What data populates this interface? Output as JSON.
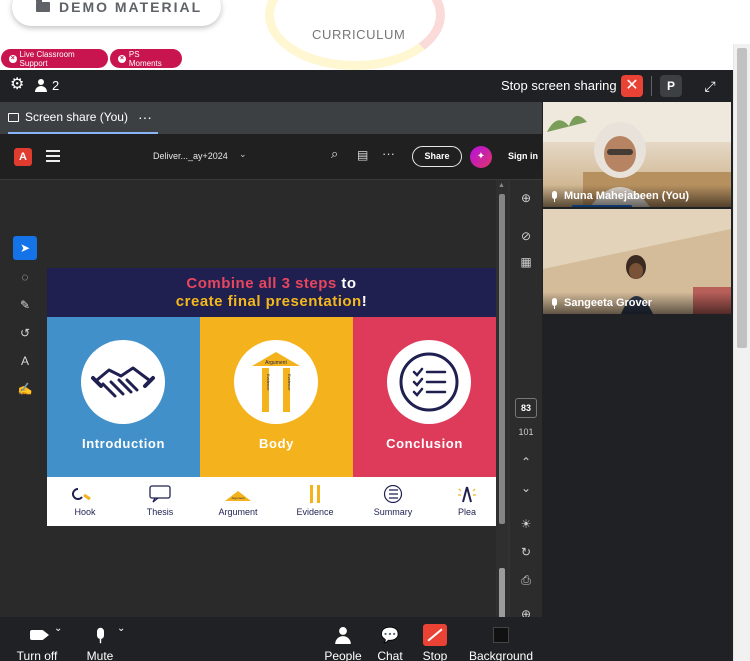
{
  "page": {
    "demo_button_label": "DEMO MATERIAL",
    "curriculum_label": "CURRICULUM",
    "chips": [
      {
        "label": "Live Classroom Support"
      },
      {
        "label": "PS Moments"
      }
    ]
  },
  "meeting": {
    "participant_count": "2",
    "stop_sharing_label": "Stop screen sharing",
    "stop_x": "✕",
    "profile_initial": "P",
    "share_tab_label": "Screen share (You)",
    "more_label": "···",
    "participants": [
      {
        "name": "Muna Mahejabeen (You)"
      },
      {
        "name": "Sangeeta Grover"
      }
    ],
    "controls": [
      {
        "label": "Turn off",
        "icon": "camera-icon"
      },
      {
        "label": "Mute",
        "icon": "mic-icon"
      },
      {
        "label": "People",
        "icon": "people-icon"
      },
      {
        "label": "Chat",
        "icon": "chat-icon"
      },
      {
        "label": "Stop",
        "icon": "stop-share-icon"
      },
      {
        "label": "Background",
        "icon": "background-icon"
      }
    ]
  },
  "pdf_viewer": {
    "document_name": "Deliver..._ay+2024",
    "share_label": "Share",
    "sign_in_label": "Sign in",
    "current_page": "83",
    "total_pages": "101"
  },
  "slide": {
    "heading_line1_colored": "Combine all 3 steps",
    "heading_line1_rest": " to",
    "heading_line2_colored": "create final presentation",
    "heading_line2_rest": "!",
    "panels": [
      {
        "title": "Introduction",
        "color": "#4190c9",
        "icon": "handshake-icon"
      },
      {
        "title": "Body",
        "color": "#f4b31c",
        "icon": "argument-pillars-icon",
        "pillar_caption": "Argument",
        "pillar_label": "Evidence"
      },
      {
        "title": "Conclusion",
        "color": "#de3b5b",
        "icon": "checklist-icon"
      }
    ],
    "strip": [
      {
        "label": "Hook",
        "icon": "hook-icon"
      },
      {
        "label": "Thesis",
        "icon": "speech-bubble-icon"
      },
      {
        "label": "Argument",
        "icon": "roof-icon",
        "caption": "Argument"
      },
      {
        "label": "Evidence",
        "icon": "pillars-icon"
      },
      {
        "label": "Summary",
        "icon": "list-circle-icon"
      },
      {
        "label": "Plea",
        "icon": "plea-icon"
      }
    ]
  },
  "colors": {
    "meeting_bg": "#202124",
    "accent_blue": "#1a73e8",
    "stop_red": "#ea4335",
    "chip_red": "#c8144f",
    "slide_navy": "#1f2050"
  }
}
